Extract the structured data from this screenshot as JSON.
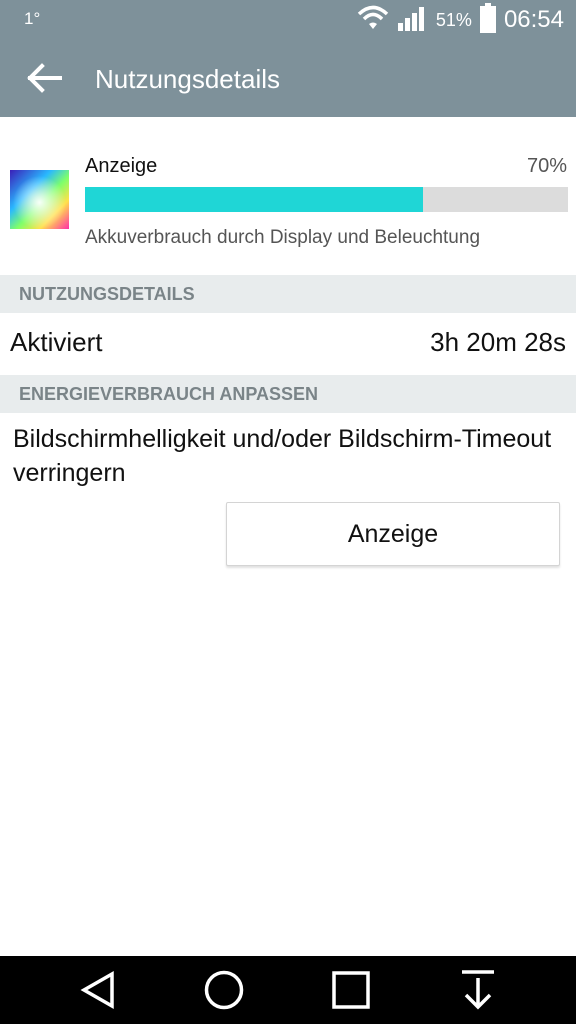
{
  "status_bar": {
    "left_text": "1°",
    "battery_percent": "51%",
    "time": "06:54"
  },
  "app_bar": {
    "title": "Nutzungsdetails",
    "back_icon": "arrow-left-icon"
  },
  "usage_item": {
    "name": "Anzeige",
    "percent_label": "70%",
    "usage_fraction": 0.7,
    "description": "Akkuverbrauch durch Display und Beleuchtung",
    "bar_color": "#1fd6d6"
  },
  "sections": {
    "usage_header": "NUTZUNGSDETAILS",
    "usage_row": {
      "label": "Aktiviert",
      "value": "3h 20m 28s"
    },
    "power_header": "ENERGIEVERBRAUCH ANPASSEN",
    "power_tip": "Bildschirmhelligkeit und/oder Bildschirm-Timeout verringern",
    "power_button": "Anzeige"
  },
  "nav_bar": {
    "items": [
      "back-triangle-icon",
      "home-circle-icon",
      "recents-square-icon",
      "notifications-pull-icon"
    ]
  },
  "colors": {
    "header_bg": "#7e919a",
    "section_bg": "#e8eced",
    "section_text": "#7a8488"
  }
}
